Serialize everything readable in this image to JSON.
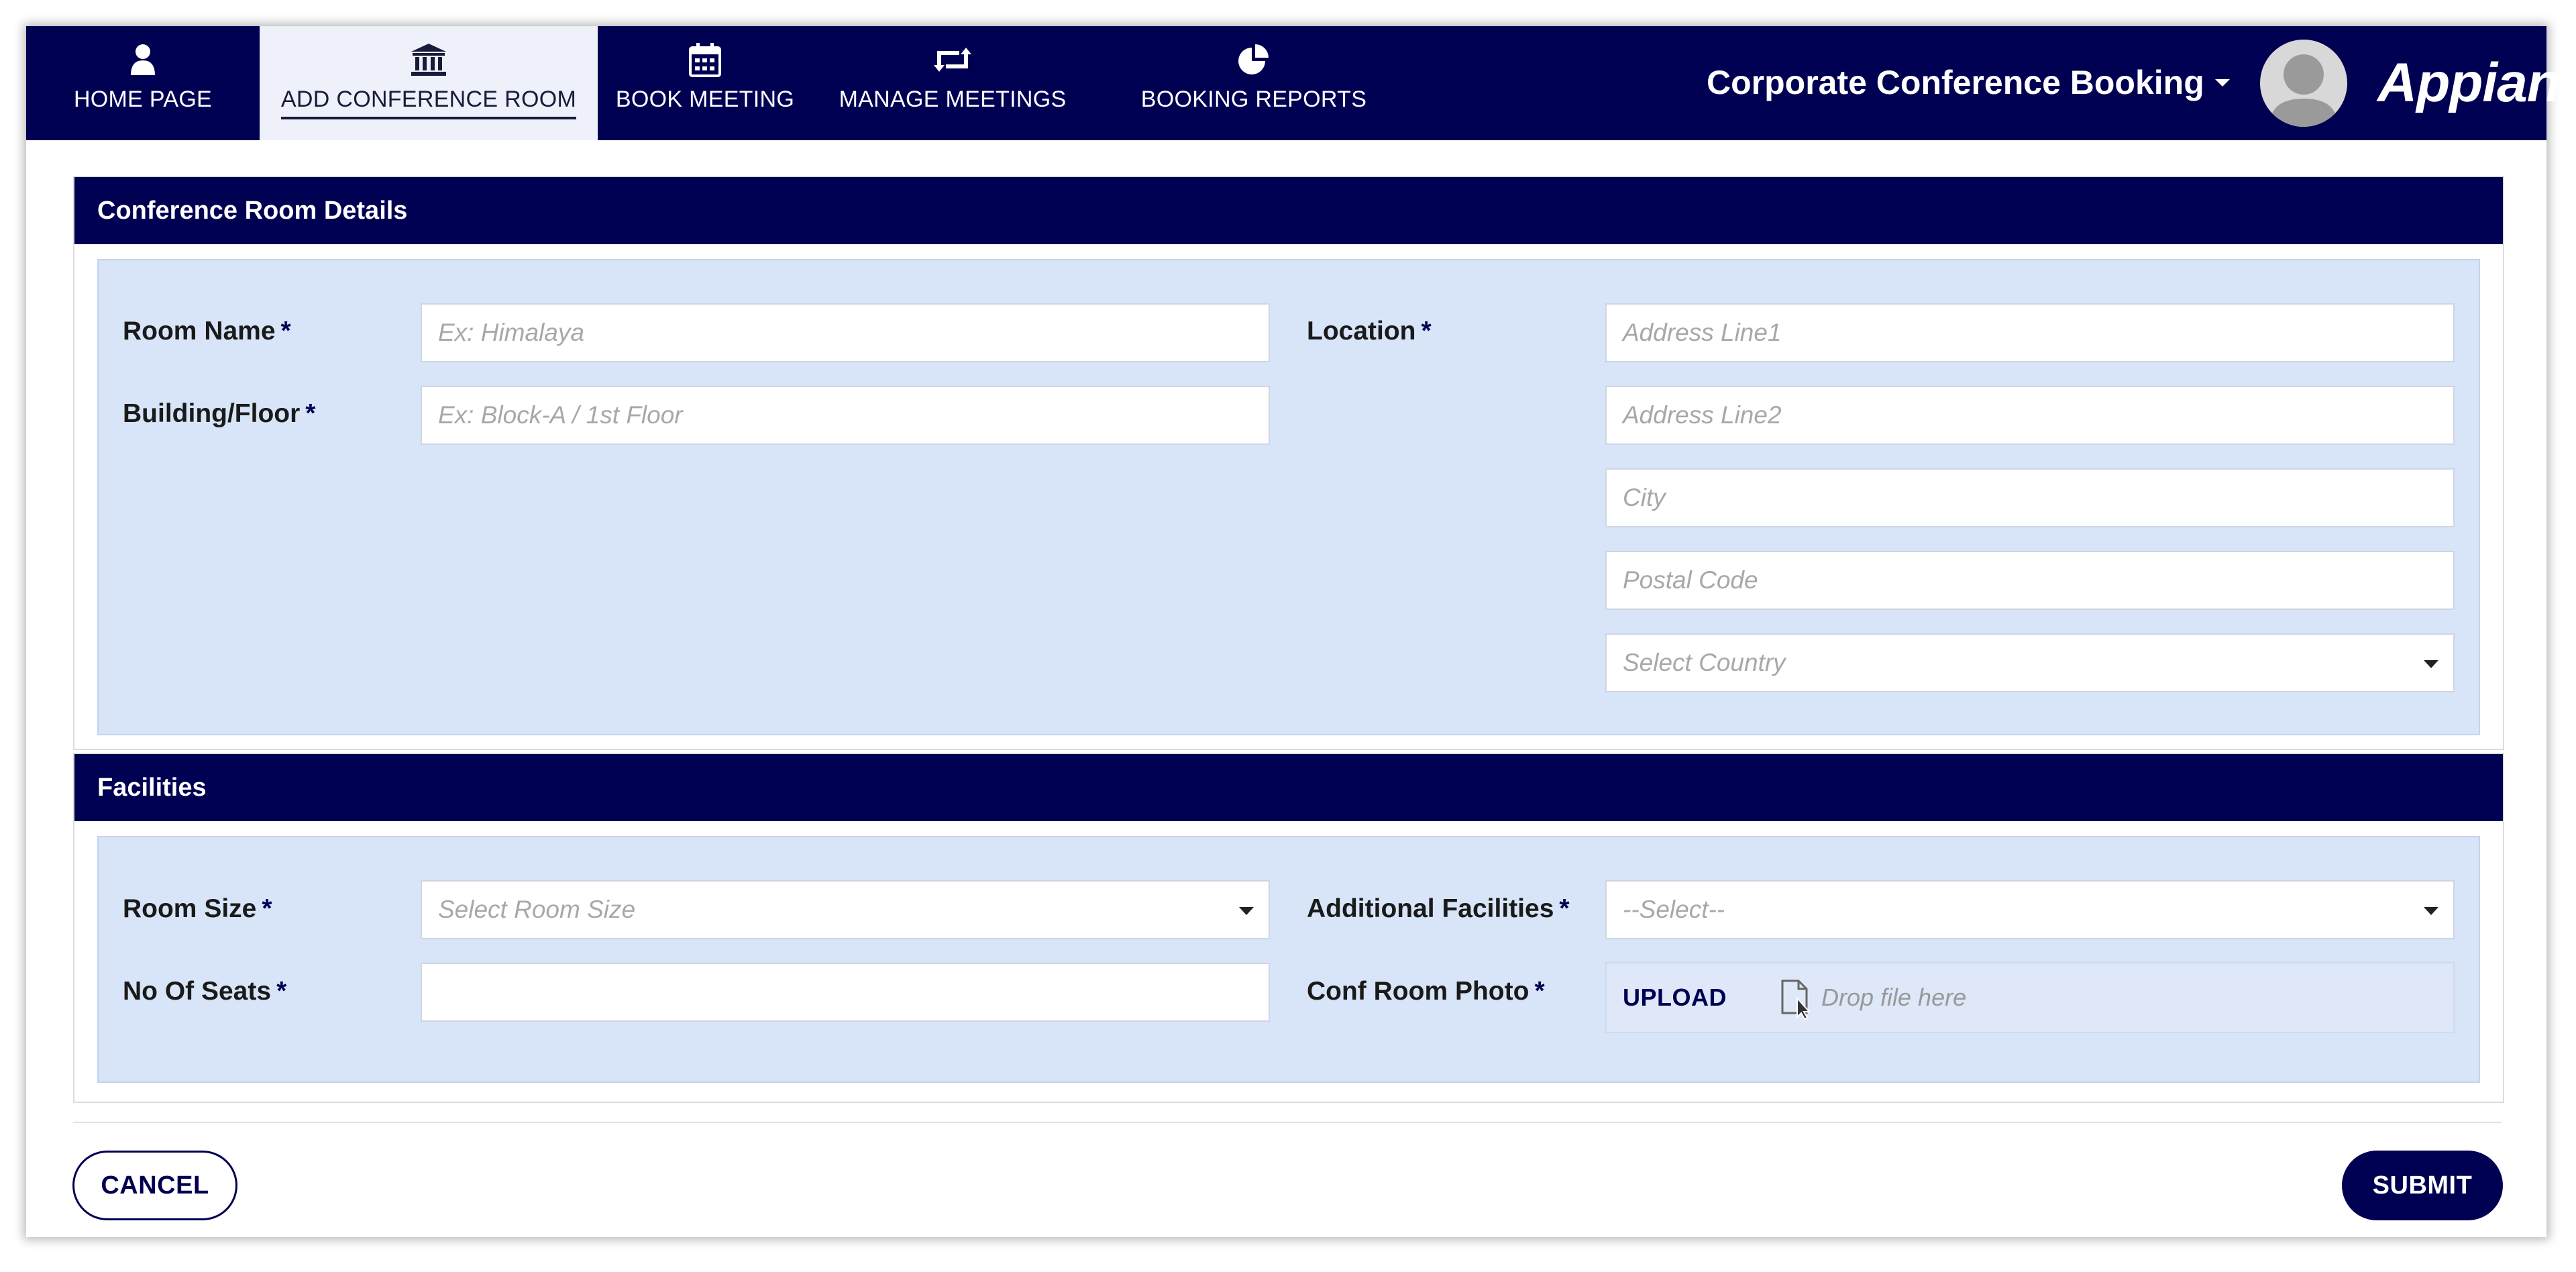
{
  "nav": {
    "tabs": [
      {
        "label": "HOME PAGE",
        "icon": "user-icon"
      },
      {
        "label": "ADD CONFERENCE ROOM",
        "icon": "bank-icon",
        "active": true
      },
      {
        "label": "BOOK MEETING",
        "icon": "calendar-icon"
      },
      {
        "label": "MANAGE MEETINGS",
        "icon": "retweet-icon"
      },
      {
        "label": "BOOKING REPORTS",
        "icon": "pie-chart-icon"
      }
    ],
    "app_title": "Corporate Conference Booking",
    "logo": "Appian"
  },
  "details": {
    "header": "Conference Room Details",
    "room_name_label": "Room Name",
    "room_name_placeholder": "Ex: Himalaya",
    "building_label": "Building/Floor",
    "building_placeholder": "Ex: Block-A / 1st Floor",
    "location_label": "Location",
    "address1_placeholder": "Address Line1",
    "address2_placeholder": "Address Line2",
    "city_placeholder": "City",
    "postal_placeholder": "Postal Code",
    "country_placeholder": "Select Country"
  },
  "facilities": {
    "header": "Facilities",
    "room_size_label": "Room Size",
    "room_size_placeholder": "Select Room Size",
    "additional_label": "Additional Facilities",
    "additional_placeholder": "--Select--",
    "seats_label": "No Of Seats",
    "seats_value": "",
    "photo_label": "Conf Room Photo",
    "upload_label": "UPLOAD",
    "drop_text": "Drop file here"
  },
  "required_mark": "*",
  "actions": {
    "cancel": "CANCEL",
    "submit": "SUBMIT"
  },
  "colors": {
    "brand_navy": "#000052",
    "panel_blue": "#d8e4f8"
  }
}
